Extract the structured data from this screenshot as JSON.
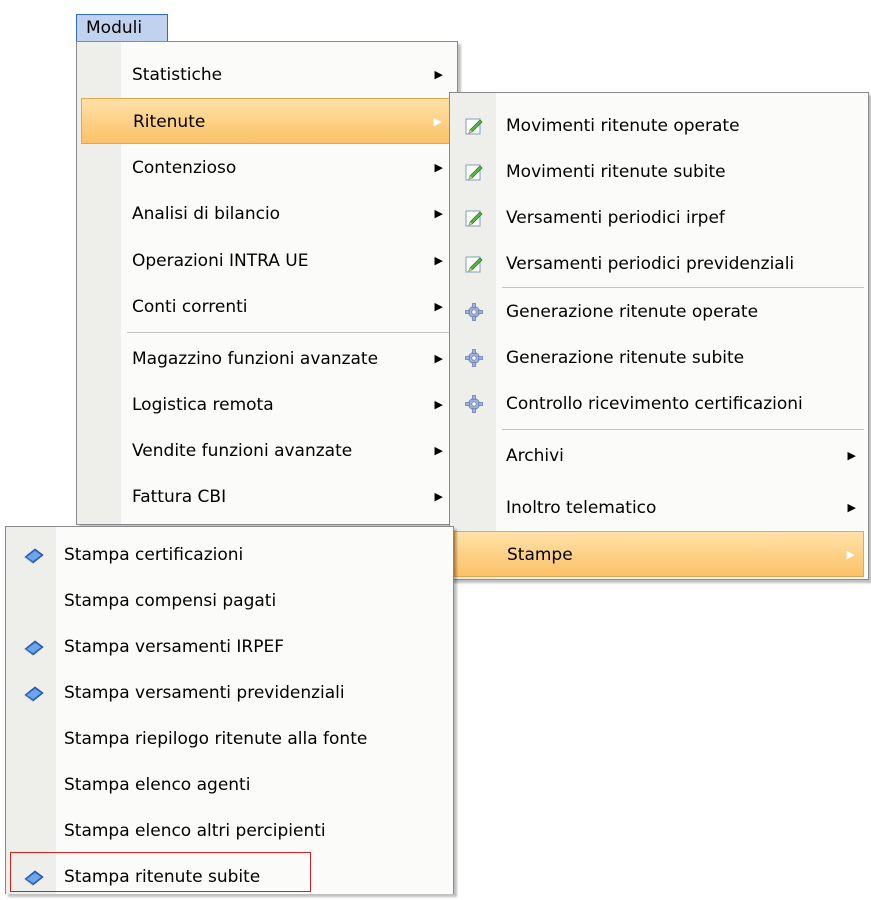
{
  "menubar": {
    "moduli_label": "Moduli"
  },
  "menu1": {
    "items": [
      {
        "label": "Statistiche"
      },
      {
        "label": "Ritenute"
      },
      {
        "label": "Contenzioso"
      },
      {
        "label": "Analisi di bilancio"
      },
      {
        "label": "Operazioni INTRA UE"
      },
      {
        "label": "Conti correnti"
      },
      {
        "label": "Magazzino funzioni avanzate"
      },
      {
        "label": "Logistica remota"
      },
      {
        "label": "Vendite funzioni avanzate"
      },
      {
        "label": "Fattura CBI"
      }
    ],
    "highlighted": "Ritenute",
    "submenu_arrow": "▶"
  },
  "menu2": {
    "items": [
      {
        "label": "Movimenti ritenute operate",
        "icon": "edit-icon"
      },
      {
        "label": "Movimenti ritenute subite",
        "icon": "edit-icon"
      },
      {
        "label": "Versamenti periodici irpef",
        "icon": "edit-icon"
      },
      {
        "label": "Versamenti periodici previdenziali",
        "icon": "edit-icon"
      },
      {
        "label": "Generazione ritenute operate",
        "icon": "gear-icon"
      },
      {
        "label": "Generazione ritenute subite",
        "icon": "gear-icon"
      },
      {
        "label": "Controllo ricevimento certificazioni",
        "icon": "gear-icon"
      },
      {
        "label": "Archivi"
      },
      {
        "label": "Inoltro telematico"
      },
      {
        "label": "Stampe"
      }
    ],
    "highlighted": "Stampe",
    "submenu_arrow": "▶"
  },
  "menu3": {
    "items": [
      {
        "label": "Stampa certificazioni",
        "icon": "print-icon"
      },
      {
        "label": "Stampa compensi pagati"
      },
      {
        "label": "Stampa versamenti IRPEF",
        "icon": "print-icon"
      },
      {
        "label": "Stampa versamenti previdenziali",
        "icon": "print-icon"
      },
      {
        "label": "Stampa riepilogo ritenute alla fonte"
      },
      {
        "label": "Stampa elenco agenti"
      },
      {
        "label": "Stampa elenco altri percipienti"
      },
      {
        "label": "Stampa ritenute subite",
        "icon": "print-icon"
      }
    ],
    "selected": "Stampa ritenute subite"
  },
  "colors": {
    "highlight_top": "#ffe2a8",
    "highlight_bottom": "#fbc168",
    "selection_border": "#d82020",
    "menubar_active": "#c1d2ee"
  }
}
